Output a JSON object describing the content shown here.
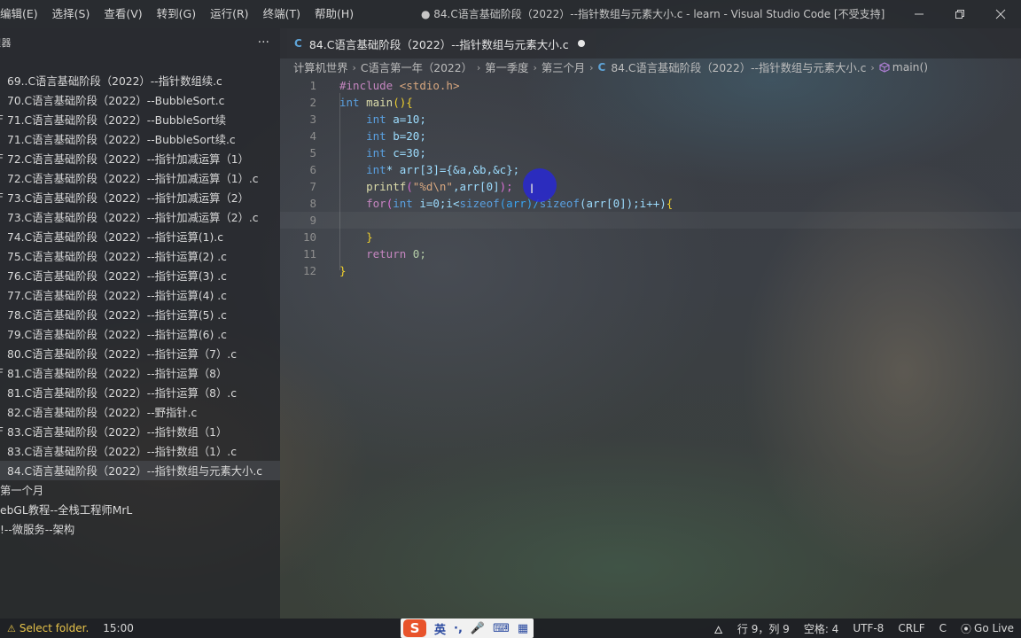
{
  "menu": [
    "编辑(E)",
    "选择(S)",
    "查看(V)",
    "转到(G)",
    "运行(R)",
    "终端(T)",
    "帮助(H)"
  ],
  "window_title": "● 84.C语言基础阶段（2022）--指针数组与元素大小.c - learn - Visual Studio Code [不受支持]",
  "sidebar": {
    "title": "理器",
    "more": "···",
    "rows": [
      {
        "prefix": "",
        "label": "69..C语言基础阶段（2022）--指针数组续.c"
      },
      {
        "prefix": "",
        "label": "70.C语言基础阶段（2022）--BubbleSort.c"
      },
      {
        "prefix": "F",
        "label": "71.C语言基础阶段（2022）--BubbleSort续"
      },
      {
        "prefix": "",
        "label": "71.C语言基础阶段（2022）--BubbleSort续.c"
      },
      {
        "prefix": "F",
        "label": "72.C语言基础阶段（2022）--指针加减运算（1）"
      },
      {
        "prefix": "",
        "label": "72.C语言基础阶段（2022）--指针加减运算（1）.c"
      },
      {
        "prefix": "F",
        "label": "73.C语言基础阶段（2022）--指针加减运算（2）"
      },
      {
        "prefix": "",
        "label": "73.C语言基础阶段（2022）--指针加减运算（2）.c"
      },
      {
        "prefix": "",
        "label": "74.C语言基础阶段（2022）--指针运算(1).c"
      },
      {
        "prefix": "",
        "label": "75.C语言基础阶段（2022）--指针运算(2) .c"
      },
      {
        "prefix": "",
        "label": "76.C语言基础阶段（2022）--指针运算(3) .c"
      },
      {
        "prefix": "",
        "label": "77.C语言基础阶段（2022）--指针运算(4) .c"
      },
      {
        "prefix": "",
        "label": "78.C语言基础阶段（2022）--指针运算(5) .c"
      },
      {
        "prefix": "",
        "label": "79.C语言基础阶段（2022）--指针运算(6) .c"
      },
      {
        "prefix": "",
        "label": "80.C语言基础阶段（2022）--指针运算（7）.c"
      },
      {
        "prefix": "F",
        "label": "81.C语言基础阶段（2022）--指针运算（8）"
      },
      {
        "prefix": "",
        "label": "81.C语言基础阶段（2022）--指针运算（8）.c"
      },
      {
        "prefix": "",
        "label": "82.C语言基础阶段（2022）--野指针.c"
      },
      {
        "prefix": "F",
        "label": "83.C语言基础阶段（2022）--指针数组（1）"
      },
      {
        "prefix": "",
        "label": "83.C语言基础阶段（2022）--指针数组（1）.c"
      },
      {
        "prefix": "",
        "label": "84.C语言基础阶段（2022）--指针数组与元素大小.c",
        "active": true
      }
    ],
    "folders": [
      "第一个月",
      "ebGL教程--全栈工程师MrL",
      "!--微服务--架构"
    ]
  },
  "tab": {
    "icon": "C",
    "title": "84.C语言基础阶段（2022）--指针数组与元素大小.c"
  },
  "breadcrumb": [
    "计算机世界",
    "C语言第一年（2022）",
    "第一季度",
    "第三个月",
    "84.C语言基础阶段（2022）--指针数组与元素大小.c",
    "main()"
  ],
  "code": {
    "line_numbers": [
      "1",
      "2",
      "3",
      "4",
      "5",
      "6",
      "7",
      "8",
      "9",
      "10",
      "11",
      "12"
    ],
    "l1_pp": "#include",
    "l1_h": " <stdio.h>",
    "l2_kw": "int",
    "l2_fn": " main",
    "l2_rest": "(){",
    "l3_kw": "int",
    "l3_rest": " a=10;",
    "l4_kw": "int",
    "l4_rest": " b=20;",
    "l5_kw": "int",
    "l5_rest": " c=30;",
    "l6_kw": "int",
    "l6_rest": "* arr[3]={&a,&b,&c};",
    "l7_fn": "printf",
    "l7_open": "(",
    "l7_str": "\"%d\\n\"",
    "l7_rest": ",arr[0]",
    "l7_close": ");",
    "l8_kw": "for",
    "l8_open": "(",
    "l8_int": "int",
    "l8_mid": " i=0;i<",
    "l8_sz1": "sizeof",
    "l8_arr": "(arr)/",
    "l8_sz2": "sizeof",
    "l8_rest": "(arr[0]);i++)",
    "l8_brace": "{",
    "l10_brace": "}",
    "l11_kw": "return",
    "l11_rest": " 0;",
    "l12_brace": "}"
  },
  "status": {
    "select_folder": "Select folder.",
    "time": "15:00",
    "ime": [
      "英",
      "·,",
      "🎤",
      "⌨",
      "▦"
    ],
    "position": "行 9，列 9",
    "spaces": "空格: 4",
    "encoding": "UTF-8",
    "eol": "CRLF",
    "language": "C",
    "go_live": "Go Live"
  }
}
